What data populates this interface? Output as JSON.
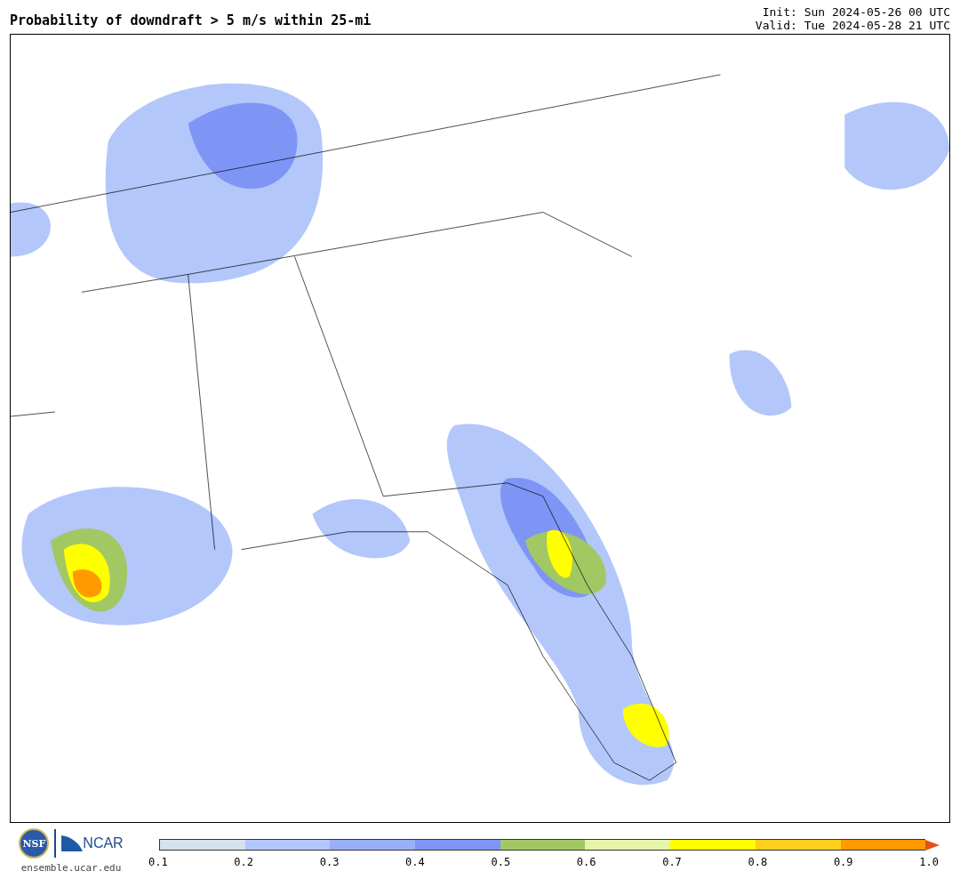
{
  "title": "Probability of downdraft > 5 m/s within 25-mi",
  "init": "Init: Sun 2024-05-26 00 UTC",
  "valid": "Valid: Tue 2024-05-28 21 UTC",
  "logos": {
    "nsf": "NSF",
    "ncar": "NCAR",
    "url": "ensemble.ucar.edu"
  },
  "colorbar": {
    "bins": [
      {
        "color": "#d6e2ee"
      },
      {
        "color": "#b3c7fb"
      },
      {
        "color": "#99b0f8"
      },
      {
        "color": "#7f95f5"
      },
      {
        "color": "#a2c864"
      },
      {
        "color": "#e6f5a8"
      },
      {
        "color": "#ffff00"
      },
      {
        "color": "#ffcf1a"
      },
      {
        "color": "#ff9a00"
      },
      {
        "color": "#e8501a",
        "kind": "extend"
      }
    ],
    "ticks": [
      "0.1",
      "0.2",
      "0.3",
      "0.4",
      "0.5",
      "0.6",
      "0.7",
      "0.8",
      "0.9",
      "1.0"
    ]
  }
}
